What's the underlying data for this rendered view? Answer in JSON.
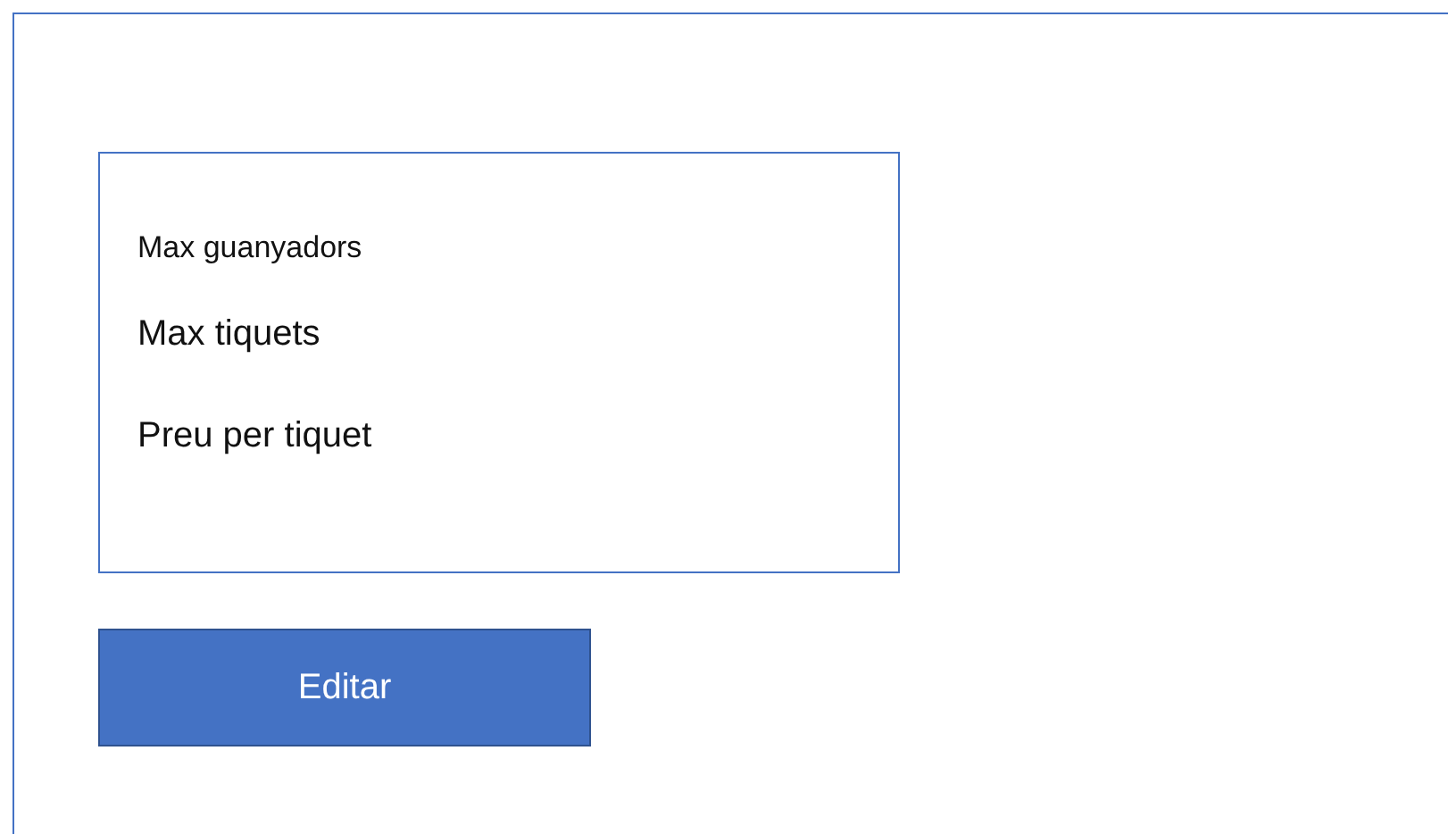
{
  "panel": {
    "fields": [
      {
        "label": "Max guanyadors",
        "kind": "small"
      },
      {
        "label": "Max tiquets",
        "kind": "large"
      },
      {
        "label": "Preu per tiquet",
        "kind": "large"
      }
    ]
  },
  "buttons": [
    {
      "label": "Editar"
    }
  ]
}
